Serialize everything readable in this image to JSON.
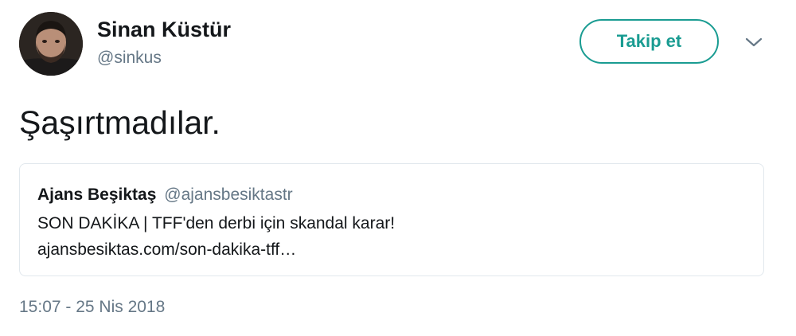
{
  "author": {
    "display_name": "Sinan Küstür",
    "handle": "@sinkus"
  },
  "follow_button_label": "Takip et",
  "icons": {
    "avatar": "profile-photo",
    "menu": "chevron-down-icon"
  },
  "tweet": {
    "text": "Şaşırtmadılar.",
    "timestamp": "15:07 - 25 Nis 2018"
  },
  "quoted_tweet": {
    "author_name": "Ajans Beşiktaş",
    "author_handle": "@ajansbesiktastr",
    "text": "SON DAKİKA | TFF'den derbi için skandal karar!",
    "link": "ajansbesiktas.com/son-dakika-tff…"
  },
  "colors": {
    "accent": "#1a9c92",
    "secondary_text": "#657786",
    "border": "#e1e8ed"
  }
}
